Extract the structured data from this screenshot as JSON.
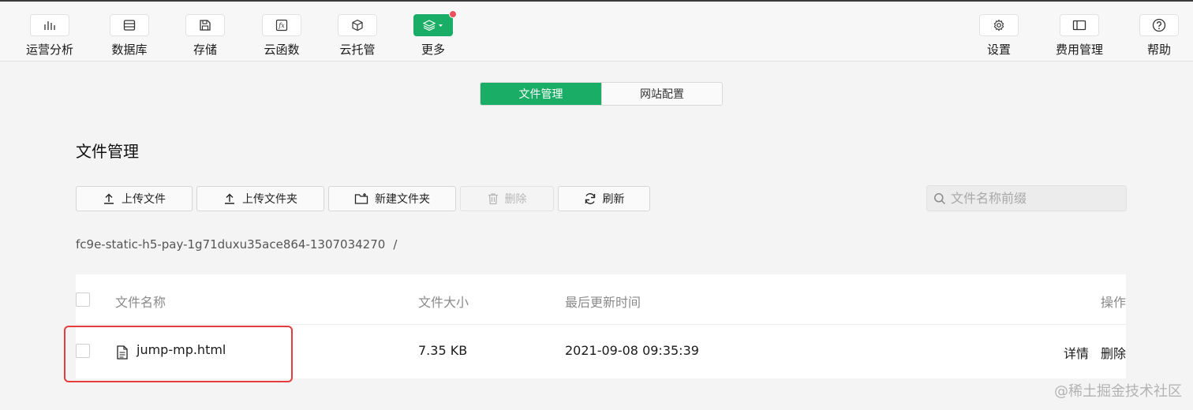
{
  "toolbar": {
    "left": [
      {
        "label": "运营分析",
        "icon": "bar-chart-icon"
      },
      {
        "label": "数据库",
        "icon": "database-icon"
      },
      {
        "label": "存储",
        "icon": "save-icon"
      },
      {
        "label": "云函数",
        "icon": "function-icon"
      },
      {
        "label": "云托管",
        "icon": "box-icon"
      },
      {
        "label": "更多",
        "icon": "layers-icon"
      }
    ],
    "right": [
      {
        "label": "设置",
        "icon": "gear-icon"
      },
      {
        "label": "费用管理",
        "icon": "sidebar-panel-icon"
      },
      {
        "label": "帮助",
        "icon": "help-icon"
      }
    ]
  },
  "tabs": {
    "file_manage": "文件管理",
    "site_config": "网站配置"
  },
  "page": {
    "title": "文件管理"
  },
  "actions": {
    "upload_file": "上传文件",
    "upload_folder": "上传文件夹",
    "new_folder": "新建文件夹",
    "delete": "删除",
    "refresh": "刷新"
  },
  "search": {
    "placeholder": "文件名称前缀"
  },
  "path": {
    "bucket": "fc9e-static-h5-pay-1g71duxu35ace864-1307034270",
    "sep": "/"
  },
  "table": {
    "headers": {
      "name": "文件名称",
      "size": "文件大小",
      "updated": "最后更新时间",
      "ops": "操作"
    },
    "rows": [
      {
        "name": "jump-mp.html",
        "size": "7.35 KB",
        "updated": "2021-09-08 09:35:39",
        "detail": "详情",
        "delete": "删除"
      }
    ]
  },
  "watermark": "@稀土掘金技术社区",
  "colors": {
    "accent": "#1aad65",
    "link": "#1f9be0",
    "highlight": "#e53d3d"
  }
}
